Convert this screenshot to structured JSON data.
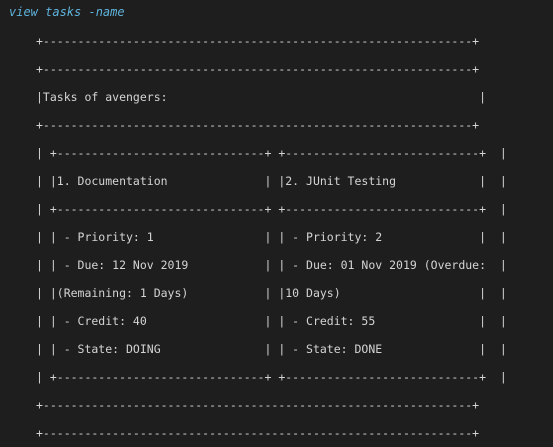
{
  "command": "view tasks -name",
  "output_lines": [
    "+--------------------------------------------------------------+",
    "+--------------------------------------------------------------+",
    "|Tasks of avengers:                                             |",
    "+--------------------------------------------------------------+",
    "| +------------------------------+ +----------------------------+  |",
    "| |1. Documentation              | |2. JUnit Testing            |  |",
    "| +------------------------------+ +----------------------------+  |",
    "| | - Priority: 1                | | - Priority: 2              |  |",
    "| | - Due: 12 Nov 2019           | | - Due: 01 Nov 2019 (Overdue:  |",
    "| |(Remaining: 1 Days)           | |10 Days)                    |  |",
    "| | - Credit: 40                 | | - Credit: 55               |  |",
    "| | - State: DOING               | | - State: DONE              |  |",
    "| +------------------------------+ +----------------------------+  |",
    "+--------------------------------------------------------------+",
    "+--------------------------------------------------------------+"
  ]
}
